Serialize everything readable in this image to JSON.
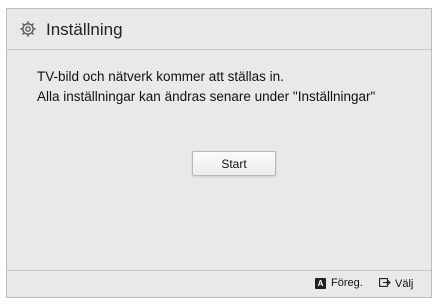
{
  "dialog": {
    "title": "Inställning",
    "icon": "gear-icon",
    "message_line1": "TV-bild och nätverk kommer att ställas in.",
    "message_line2": "Alla inställningar kan ändras senare under \"Inställningar\"",
    "start_label": "Start"
  },
  "footer": {
    "a_key_label": "A",
    "prev_label": "Föreg.",
    "select_icon": "enter-icon",
    "select_label": "Välj"
  },
  "colors": {
    "panel_bg": "#e9e9e9",
    "border": "#bdbdbd",
    "text": "#111111"
  }
}
